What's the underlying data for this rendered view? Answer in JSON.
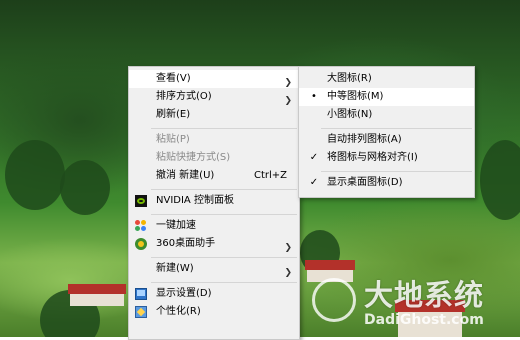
{
  "context_menu": {
    "items": [
      {
        "label": "查看(V)",
        "has_submenu": true
      },
      {
        "label": "排序方式(O)",
        "has_submenu": true
      },
      {
        "label": "刷新(E)"
      },
      {
        "label": "粘贴(P)",
        "disabled": true
      },
      {
        "label": "粘贴快捷方式(S)",
        "disabled": true
      },
      {
        "label": "撤消 新建(U)",
        "shortcut": "Ctrl+Z"
      },
      {
        "label": "NVIDIA 控制面板",
        "icon": "nvidia-icon"
      },
      {
        "label": "一键加速",
        "icon": "speed-boost-icon"
      },
      {
        "label": "360桌面助手",
        "icon": "360-desktop-icon",
        "has_submenu": true
      },
      {
        "label": "新建(W)",
        "has_submenu": true
      },
      {
        "label": "显示设置(D)",
        "icon": "display-settings-icon"
      },
      {
        "label": "个性化(R)",
        "icon": "personalize-icon"
      }
    ]
  },
  "view_submenu": {
    "items": [
      {
        "label": "大图标(R)"
      },
      {
        "label": "中等图标(M)",
        "selected": true,
        "mark": "•"
      },
      {
        "label": "小图标(N)"
      },
      {
        "label": "自动排列图标(A)"
      },
      {
        "label": "将图标与网格对齐(I)",
        "checked": true,
        "mark": "✓"
      },
      {
        "label": "显示桌面图标(D)",
        "checked": true,
        "mark": "✓"
      }
    ]
  },
  "watermark": {
    "title": "大地系统",
    "url": "DadiGhost.com"
  },
  "colors": {
    "menu_bg": "#f0f0f0",
    "hover_bg": "#ffffff",
    "disabled_text": "#8a8a8a",
    "nvidia_green": "#76b900"
  }
}
